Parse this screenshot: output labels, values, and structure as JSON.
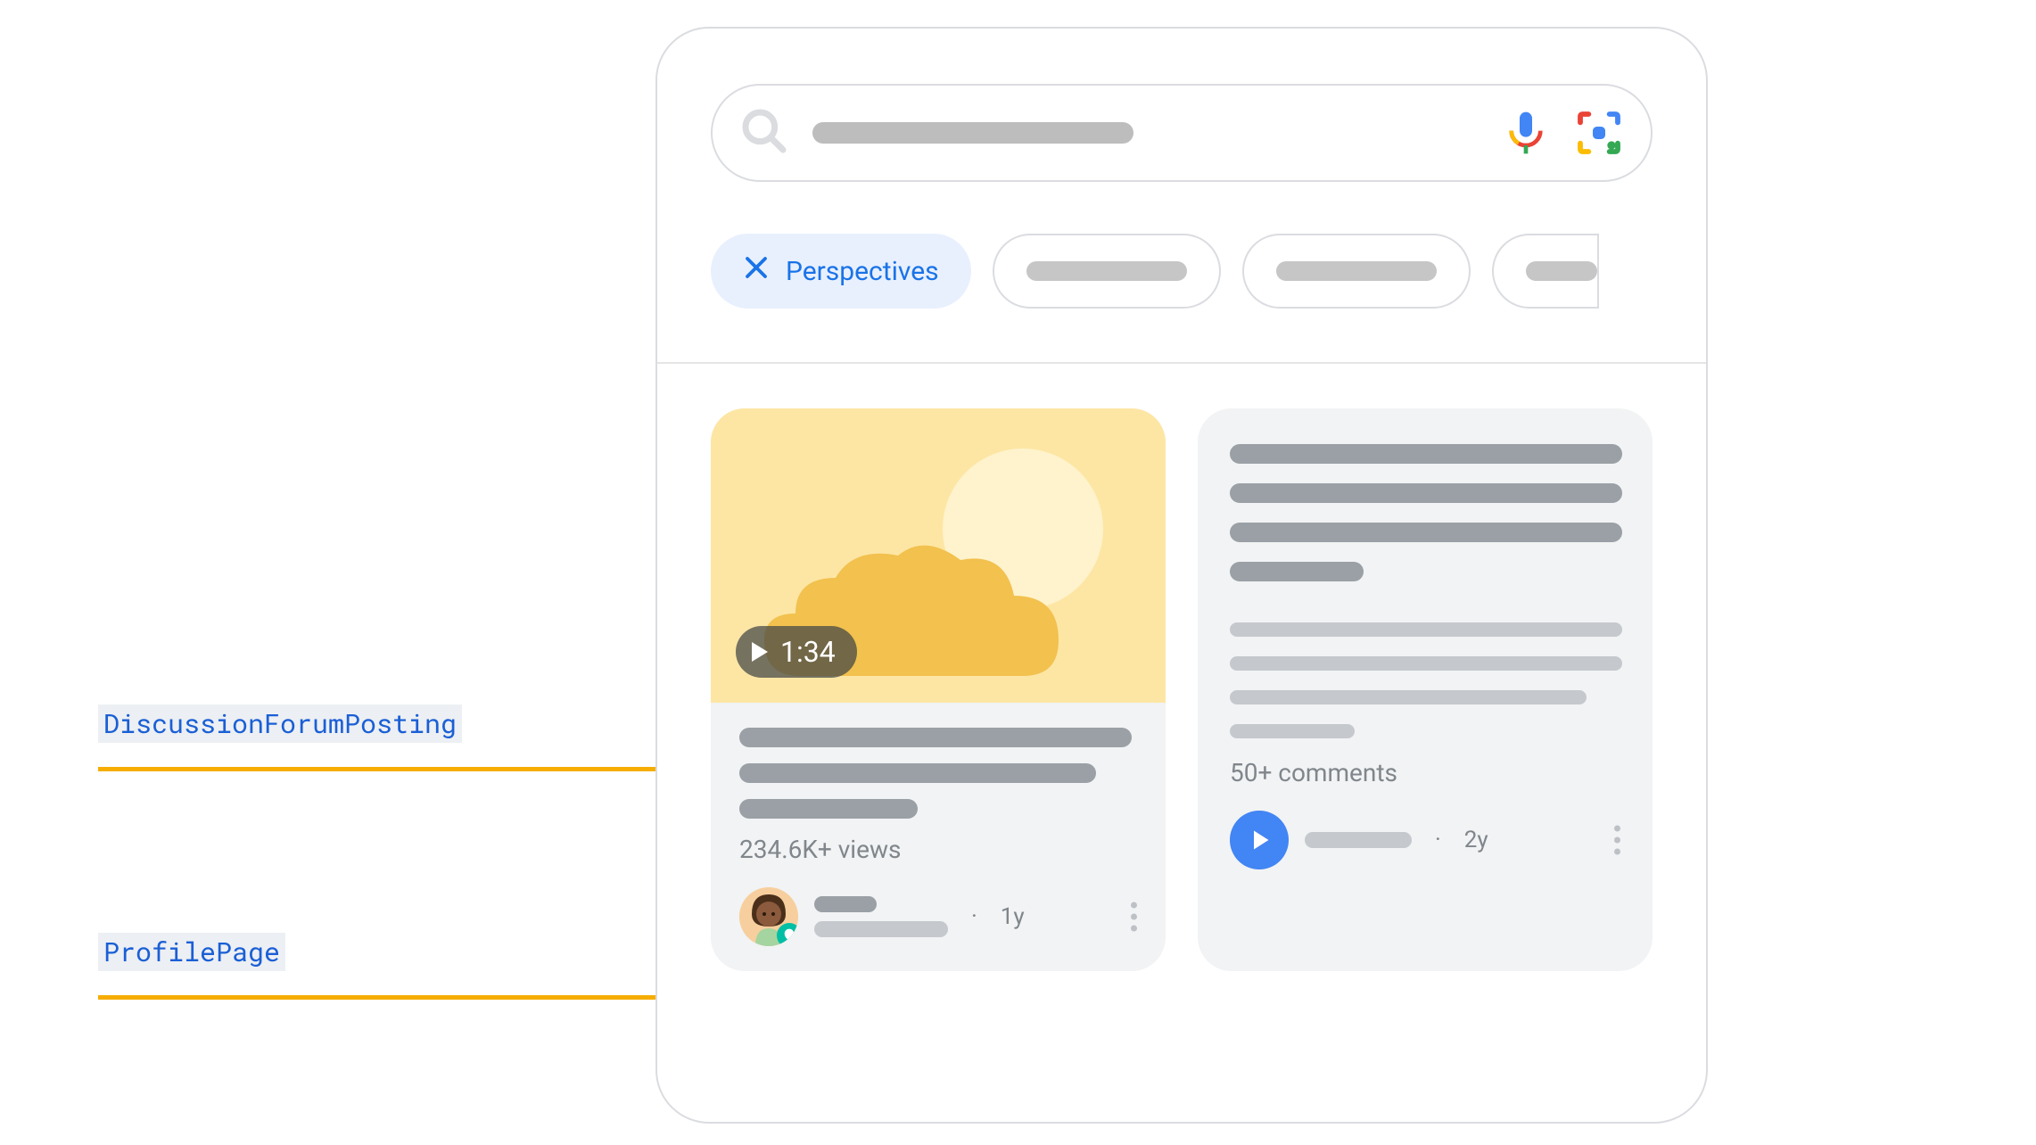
{
  "annotations": {
    "discussion_forum_posting": "DiscussionForumPosting",
    "profile_page": "ProfilePage"
  },
  "chips": {
    "active_label": "Perspectives"
  },
  "video_card": {
    "duration": "1:34",
    "views": "234.6K+ views",
    "age": "1y"
  },
  "forum_card": {
    "comments": "50+ comments",
    "age": "2y"
  },
  "colors": {
    "accent_blue": "#1a73e8",
    "annotation_line": "#f6ad00",
    "label_text": "#1a5fd6"
  }
}
